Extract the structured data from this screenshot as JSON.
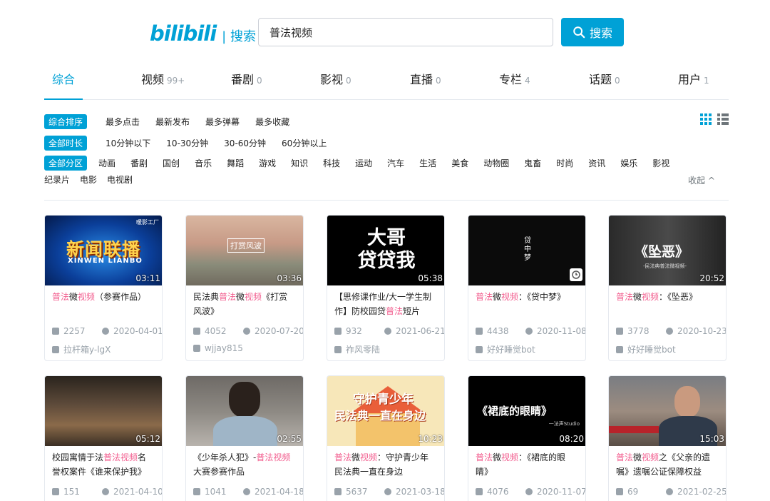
{
  "header": {
    "logo": "bilibili",
    "logo_sub": "搜索",
    "search_value": "普法视频",
    "search_button": "搜索"
  },
  "tabs": [
    {
      "label": "综合",
      "count": ""
    },
    {
      "label": "视频",
      "count": "99+"
    },
    {
      "label": "番剧",
      "count": "0"
    },
    {
      "label": "影视",
      "count": "0"
    },
    {
      "label": "直播",
      "count": "0"
    },
    {
      "label": "专栏",
      "count": "4"
    },
    {
      "label": "话题",
      "count": "0"
    },
    {
      "label": "用户",
      "count": "1"
    }
  ],
  "filters": {
    "order": [
      "综合排序",
      "最多点击",
      "最新发布",
      "最多弹幕",
      "最多收藏"
    ],
    "duration": [
      "全部时长",
      "10分钟以下",
      "10-30分钟",
      "30-60分钟",
      "60分钟以上"
    ],
    "zone_line1": [
      "全部分区",
      "动画",
      "番剧",
      "国创",
      "音乐",
      "舞蹈",
      "游戏",
      "知识",
      "科技",
      "运动",
      "汽车",
      "生活",
      "美食",
      "动物圈",
      "鬼畜",
      "时尚",
      "资讯",
      "娱乐",
      "影视"
    ],
    "zone_line2": [
      "纪录片",
      "电影",
      "电视剧"
    ],
    "collapse": "收起 ^"
  },
  "colors": {
    "accent": "#00a1d6",
    "keyword": "#f25d8e",
    "muted": "#99a2aa"
  },
  "cards": [
    {
      "duration": "03:11",
      "thumb_text": "新闻联播",
      "thumb_sub": "XINWEN LIANBO",
      "thumb_badge": "暖影工厂",
      "title_pre": "",
      "title_kw1": "普法",
      "title_mid": "微",
      "title_kw2": "视频",
      "title_post": "（参赛作品）",
      "plays": "2257",
      "date": "2020-04-01",
      "uploader": "拉杆箱y-lgX"
    },
    {
      "duration": "03:36",
      "thumb_text": "打赏风波",
      "title_pre": "民法典",
      "title_kw1": "普法",
      "title_mid": "微",
      "title_kw2": "视频",
      "title_post": "《打赏风波》",
      "plays": "4052",
      "date": "2020-07-20",
      "uploader": "wjjay815"
    },
    {
      "duration": "05:38",
      "thumb_text": "大哥 贷贷我",
      "title_pre": "【思修课作业/大一学生制作】防校园贷",
      "title_kw1": "普法",
      "title_mid": "短片《大",
      "title_kw2": "",
      "title_post": "",
      "plays": "932",
      "date": "2021-06-21",
      "uploader": "祚风零陆"
    },
    {
      "duration": "",
      "thumb_text": "贷中梦",
      "title_pre": "",
      "title_kw1": "普法",
      "title_mid": "微",
      "title_kw2": "视频",
      "title_post": "：《贷中梦》",
      "plays": "4438",
      "date": "2020-11-08",
      "uploader": "好好睡觉bot"
    },
    {
      "duration": "20:52",
      "thumb_text": "《坠恶》",
      "thumb_sub": "-民法典普法微视频-",
      "title_pre": "",
      "title_kw1": "普法",
      "title_mid": "微",
      "title_kw2": "视频",
      "title_post": "：《坠恶》",
      "plays": "3778",
      "date": "2020-10-23",
      "uploader": "好好睡觉bot"
    },
    {
      "duration": "05:12",
      "title_pre": "校园寓情于法",
      "title_kw1": "普法",
      "title_mid": "",
      "title_kw2": "视频",
      "title_post": "名誉权案件《谁来保护我》",
      "plays": "151",
      "date": "2021-04-10",
      "uploader": ""
    },
    {
      "duration": "02:55",
      "title_pre": "《少年杀人犯》-",
      "title_kw1": "普法",
      "title_mid": "",
      "title_kw2": "视频",
      "title_post": "大赛参赛作品",
      "plays": "1041",
      "date": "2021-04-18",
      "uploader": ""
    },
    {
      "duration": "10:23",
      "thumb_text": "守护青少年",
      "thumb_sub": "民法典一直在身边",
      "title_pre": "",
      "title_kw1": "普法",
      "title_mid": "微",
      "title_kw2": "视频",
      "title_post": "：守护青少年 民法典一直在身边",
      "plays": "5637",
      "date": "2021-03-18",
      "uploader": ""
    },
    {
      "duration": "08:20",
      "thumb_text": "《裙底的眼睛》",
      "thumb_sub": "一法声Studio",
      "title_pre": "",
      "title_kw1": "普法",
      "title_mid": "微",
      "title_kw2": "视频",
      "title_post": "：《裙底的眼睛》",
      "plays": "4076",
      "date": "2020-11-07",
      "uploader": ""
    },
    {
      "duration": "15:03",
      "title_pre": "",
      "title_kw1": "普法",
      "title_mid": "微",
      "title_kw2": "视频",
      "title_post": "之《父亲的遗嘱》遗嘱公证保障权益",
      "plays": "69",
      "date": "2021-02-25",
      "uploader": ""
    }
  ]
}
